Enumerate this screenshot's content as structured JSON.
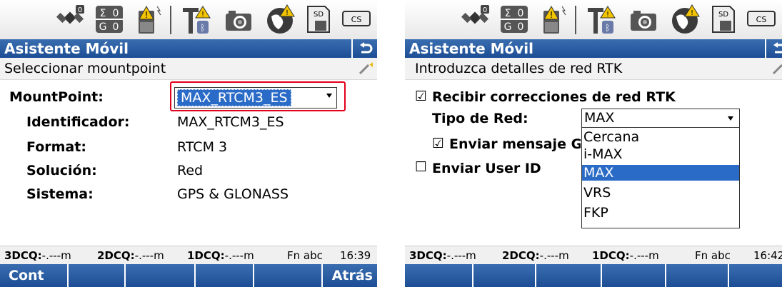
{
  "left": {
    "status_icons": [
      "satellite-icon",
      "sigma-counter-icon",
      "battery-icon",
      "rover-antenna-bluetooth-icon",
      "camera-icon",
      "globe-icon",
      "sd-card-icon",
      "cs-icon"
    ],
    "counters": {
      "top_label": "Σ",
      "top_value": "0",
      "bottom_label": "G",
      "bottom_value": "0"
    },
    "cs_label": "CS",
    "sd_label": "SD",
    "title": "Asistente Móvil",
    "subtitle": "Seleccionar mountpoint",
    "mountpoint": {
      "label": "MountPoint:",
      "value": "MAX_RTCM3_ES"
    },
    "fields": [
      {
        "label": "Identificador:",
        "value": "MAX_RTCM3_ES"
      },
      {
        "label": "Format:",
        "value": "RTCM 3"
      },
      {
        "label": "Solución:",
        "value": "Red"
      },
      {
        "label": "Sistema:",
        "value": "GPS & GLONASS"
      }
    ],
    "status": {
      "q3_label": "3DCQ:",
      "q3_value": "-.---m",
      "q2_label": "2DCQ:",
      "q2_value": "-.---m",
      "q1_label": "1DCQ:",
      "q1_value": "-.---m",
      "mode": "Fn  abc",
      "time": "16:39"
    },
    "softkeys": {
      "f1": "Cont",
      "f6": "Atrás"
    }
  },
  "right": {
    "title": "Asistente Móvil",
    "subtitle": "Introduzca detalles de red RTK",
    "receive": {
      "label": "Recibir correcciones de red RTK",
      "checked": true
    },
    "network_type": {
      "label": "Tipo de Red:",
      "value": "MAX"
    },
    "send_message": {
      "label": "Enviar mensaje G",
      "checked": true
    },
    "send_user": {
      "label": "Enviar User ID",
      "checked": false
    },
    "options": [
      "Cercana",
      "i-MAX",
      "MAX",
      "VRS",
      "FKP"
    ],
    "selected_option": "MAX",
    "status": {
      "q3_label": "3DCQ:",
      "q3_value": "-.---m",
      "q2_label": "2DCQ:",
      "q2_value": "-.---m",
      "q1_label": "1DCQ:",
      "q1_value": "-.---m",
      "mode": "Fn  abc",
      "time": "16:42"
    }
  },
  "colors": {
    "title_bar": "#1d4e95",
    "selection": "#2a6bc7",
    "highlight": "#e2001a"
  }
}
